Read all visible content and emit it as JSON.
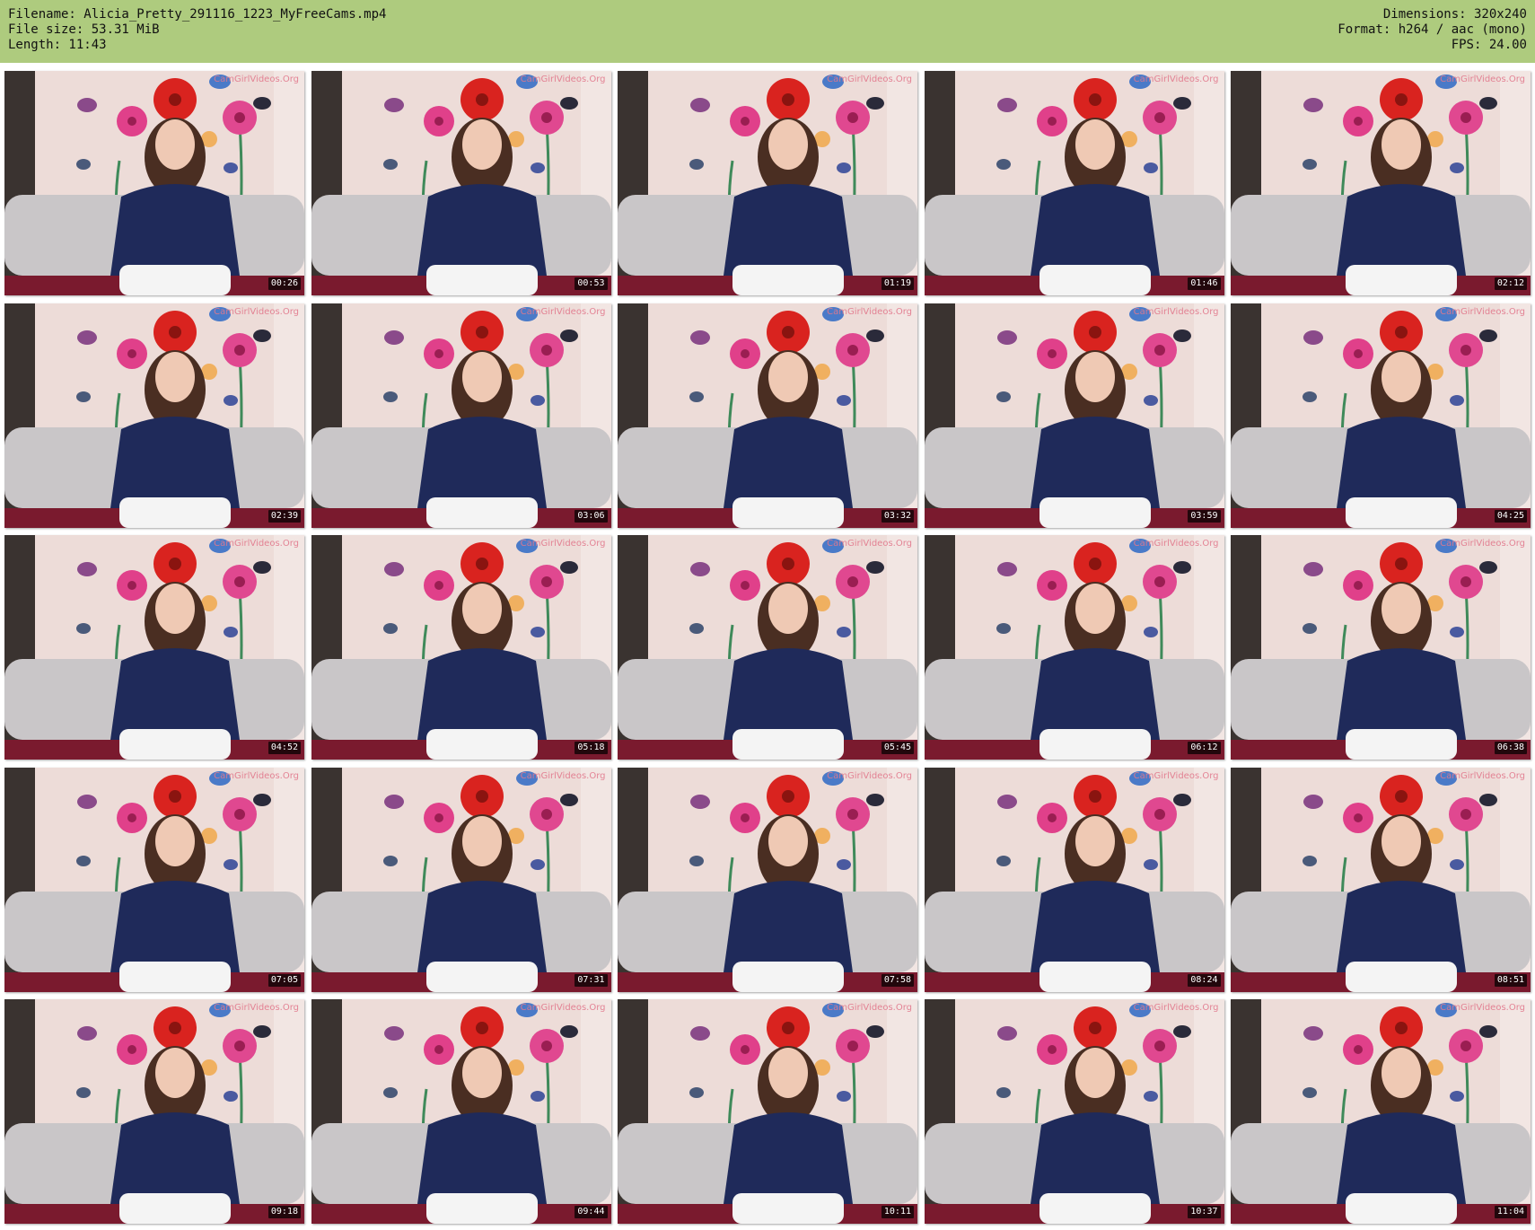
{
  "meta": {
    "filename": "Filename: Alicia_Pretty_291116_1223_MyFreeCams.mp4",
    "filesize": "File size: 53.31 MiB",
    "length": "Length: 11:43",
    "dimensions": "Dimensions: 320x240",
    "format": "Format: h264 / aac (mono)",
    "fps": "FPS: 24.00"
  },
  "watermark": "CamGirlVideos.Org",
  "colors": {
    "header_bg": "#aecb7e",
    "wall": "#eddcd8",
    "top_navy": "#1f2a5a",
    "sofa": "#c9c6c8",
    "carpet": "#7a1a2e",
    "flower_red": "#d9231f",
    "flower_pink": "#e0408a"
  },
  "timestamps": [
    "00:26",
    "00:53",
    "01:19",
    "01:46",
    "02:12",
    "02:39",
    "03:06",
    "03:32",
    "03:59",
    "04:25",
    "04:52",
    "05:18",
    "05:45",
    "06:12",
    "06:38",
    "07:05",
    "07:31",
    "07:58",
    "08:24",
    "08:51",
    "09:18",
    "09:44",
    "10:11",
    "10:37",
    "11:04"
  ]
}
